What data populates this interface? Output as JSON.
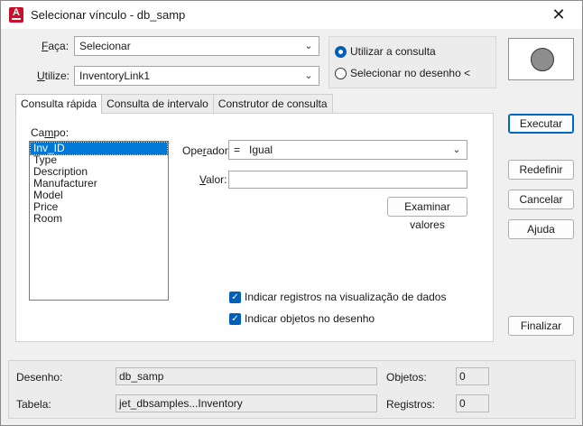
{
  "window": {
    "title": "Selecionar vínculo - db_samp",
    "icon": "autocad-app-icon",
    "close": "✕"
  },
  "form": {
    "faca_label": "Faça:",
    "faca_value": "Selecionar",
    "utilize_label": "Utilize:",
    "utilize_value": "InventoryLink1"
  },
  "mode": {
    "option_query": "Utilizar a consulta",
    "option_query_selected": true,
    "option_drawing": "Selecionar no desenho <",
    "option_drawing_selected": false
  },
  "tabs": [
    {
      "label": "Consulta rápida",
      "active": true
    },
    {
      "label": "Consulta de intervalo",
      "active": false
    },
    {
      "label": "Construtor de consulta",
      "active": false
    }
  ],
  "quick_query": {
    "campo_label": "Campo:",
    "fields": [
      "Inv_ID",
      "Type",
      "Description",
      "Manufacturer",
      "Model",
      "Price",
      "Room"
    ],
    "selected_field": "Inv_ID",
    "operador_label": "Operador:",
    "operador_value": "=   Igual",
    "valor_label": "Valor:",
    "valor_value": "",
    "examine_button": "Examinar valores",
    "check_records": "Indicar registros na visualização de dados",
    "check_records_on": true,
    "check_objects": "Indicar objetos no desenho",
    "check_objects_on": true
  },
  "buttons": {
    "execute": "Executar",
    "reset": "Redefinir",
    "cancel": "Cancelar",
    "help": "Ajuda",
    "finish": "Finalizar"
  },
  "status": {
    "desenho_label": "Desenho:",
    "desenho_value": "db_samp",
    "tabela_label": "Tabela:",
    "tabela_value": "jet_dbsamples...Inventory",
    "objetos_label": "Objetos:",
    "objetos_value": "0",
    "registros_label": "Registros:",
    "registros_value": "0"
  },
  "colors": {
    "accent": "#005fb8",
    "selection": "#0078d7",
    "app_icon": "#c8102e"
  }
}
